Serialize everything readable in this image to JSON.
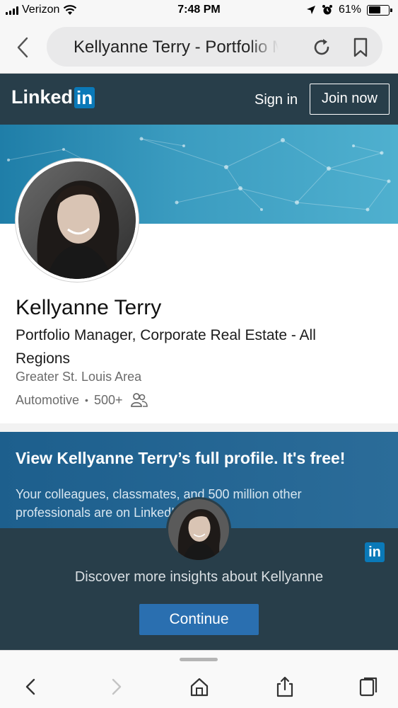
{
  "status_bar": {
    "carrier": "Verizon",
    "time": "7:48 PM",
    "battery": "61%",
    "battery_level": 0.61
  },
  "browser": {
    "url_text": "Kellyanne Terry - Portfolio Manager"
  },
  "header": {
    "logo_text": "Linked",
    "logo_box": "in",
    "sign_in": "Sign in",
    "join_now": "Join now"
  },
  "profile": {
    "name": "Kellyanne Terry",
    "headline": "Portfolio Manager, Corporate Real Estate - All Regions",
    "location": "Greater St. Louis Area",
    "industry": "Automotive",
    "connections": "500+"
  },
  "cta": {
    "title": "View Kellyanne Terry’s full profile. It's free!",
    "subtitle": "Your colleagues, classmates, and 500 million other professionals are on LinkedIn."
  },
  "insights": {
    "text": "Discover more insights about Kellyanne",
    "continue_label": "Continue",
    "badge": "in"
  },
  "colors": {
    "linkedin_dark": "#283e4a",
    "linkedin_blue": "#0a79b8",
    "button_blue": "#2a6fb0",
    "cta_blue": "#1d5f8d"
  },
  "icons": [
    "wifi-icon",
    "location-arrow-icon",
    "alarm-icon",
    "back-chevron-icon",
    "reload-icon",
    "bookmark-icon",
    "connections-icon",
    "browser-back-icon",
    "browser-forward-icon",
    "home-icon",
    "share-icon",
    "tabs-icon"
  ]
}
